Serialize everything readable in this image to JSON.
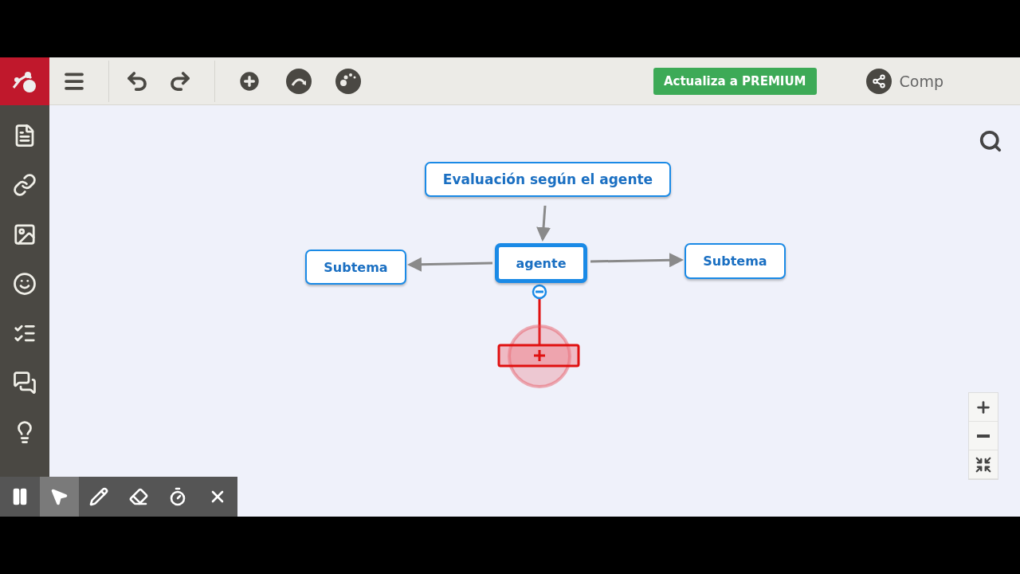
{
  "toolbar": {
    "premium_button": "Actualiza a PREMIUM",
    "share_label": "Comp"
  },
  "map": {
    "nodes": [
      {
        "kind": "central",
        "label": "Evaluación según el agente",
        "selected": false
      },
      {
        "kind": "topic",
        "label": "Subtema",
        "selected": false
      },
      {
        "kind": "topic",
        "label": "agente",
        "selected": true
      },
      {
        "kind": "topic",
        "label": "Subtema",
        "selected": false
      }
    ]
  },
  "drawing_tools": [
    {
      "kind": "pause",
      "selected": false
    },
    {
      "kind": "pointer",
      "selected": true
    },
    {
      "kind": "pen",
      "selected": false
    },
    {
      "kind": "eraser",
      "selected": false
    },
    {
      "kind": "timer",
      "selected": false
    },
    {
      "kind": "close",
      "selected": false
    }
  ]
}
